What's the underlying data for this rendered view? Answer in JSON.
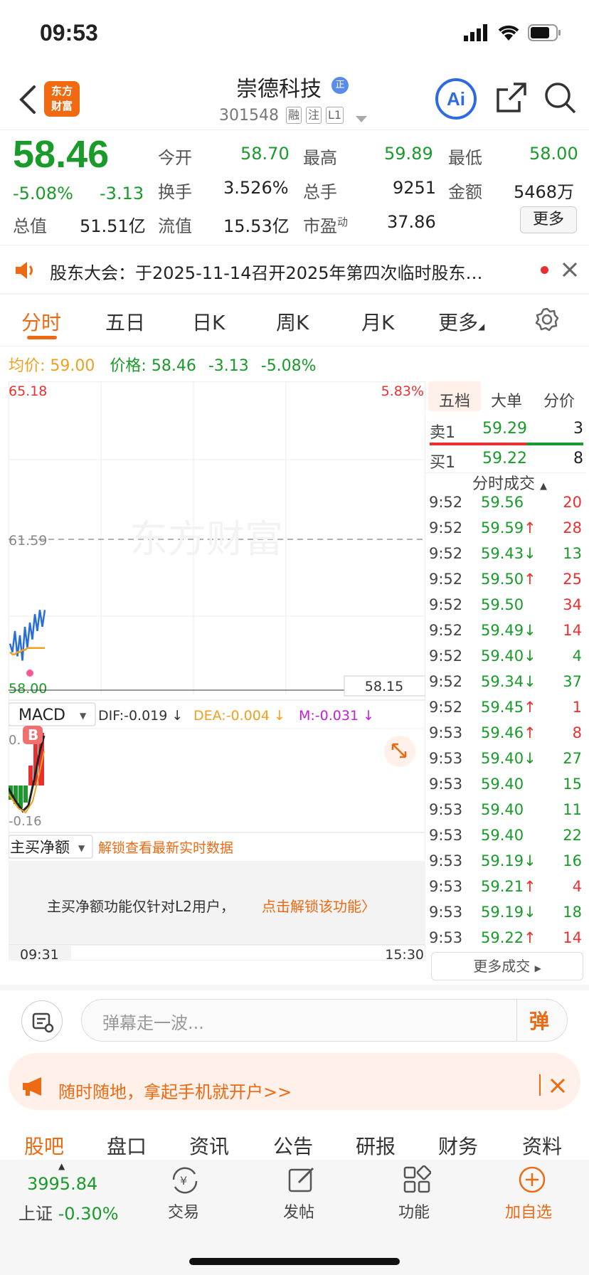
{
  "status": {
    "time": "09:53"
  },
  "header": {
    "logo_text": "东方财富",
    "stock_name": "崇德科技",
    "stock_code": "301548",
    "tags": [
      "融",
      "注",
      "L1"
    ],
    "ai_label": "Ai"
  },
  "quote": {
    "price": "58.46",
    "change_pct": "-5.08%",
    "change": "-3.13",
    "open_label": "今开",
    "open": "58.70",
    "high_label": "最高",
    "high": "59.89",
    "low_label": "最低",
    "low": "58.00",
    "turnover_label": "换手",
    "turnover": "3.526%",
    "volume_label": "总手",
    "volume": "9251",
    "amount_label": "金额",
    "amount": "5468万",
    "mktcap_label": "总值",
    "mktcap": "51.51亿",
    "float_label": "流值",
    "float_cap": "15.53亿",
    "pe_label": "市盈",
    "pe_sup": "动",
    "pe": "37.86",
    "more_label": "更多"
  },
  "notice": {
    "text": "股东大会：于2025-11-14召开2025年第四次临时股东…"
  },
  "ktabs": [
    "分时",
    "五日",
    "日K",
    "周K",
    "月K",
    "更多"
  ],
  "avg": {
    "avg_label": "均价:",
    "avg_value": "59.00",
    "price_label": "价格:",
    "price": "58.46",
    "change": "-3.13",
    "change_pct": "-5.08%"
  },
  "chart_data": {
    "type": "line",
    "y_top": "65.18",
    "y_mid": "61.59",
    "y_bottom": "58.00",
    "pct_top": "5.83%",
    "crosshair_value": "58.15",
    "x_start": "09:31",
    "x_end": "15:30",
    "ylim": [
      58.0,
      65.18
    ],
    "series": [
      {
        "values": [
          59.1,
          58.9,
          59.4,
          58.8,
          59.3,
          58.7,
          59.5,
          59.0,
          59.6,
          59.2,
          59.8,
          59.4,
          59.9,
          59.5,
          59.9
        ]
      },
      {
        "values": [
          58.9,
          58.85,
          58.85,
          58.9,
          58.9,
          58.95,
          58.95,
          59.0,
          59.0,
          59.0,
          59.0,
          59.0,
          59.0,
          59.0,
          59.0
        ]
      }
    ],
    "watermark": "东方财富"
  },
  "macd": {
    "label": "MACD",
    "dif": "DIF:-0.019 ↓",
    "dea": "DEA:-0.004 ↓",
    "m": "M:-0.031 ↓",
    "y_top": "0.",
    "y_bottom": "-0.16",
    "b_marker": "B"
  },
  "netbuy": {
    "label": "主买净额",
    "unlock_link": "解锁查看最新实时数据",
    "desc": "主买净额功能仅针对L2用户，",
    "desc_link": "点击解锁该功能〉"
  },
  "orderbook": {
    "tabs": [
      "五档",
      "大单",
      "分价"
    ],
    "sell1": {
      "label": "卖1",
      "price": "59.29",
      "vol": "3"
    },
    "buy1": {
      "label": "买1",
      "price": "59.22",
      "vol": "8"
    },
    "trades_title": "分时成交",
    "trades": [
      {
        "t": "9:52",
        "p": "59.56",
        "a": "",
        "v": "20",
        "c": "green",
        "vc": "red"
      },
      {
        "t": "9:52",
        "p": "59.59",
        "a": "↑",
        "v": "28",
        "c": "green",
        "vc": "red"
      },
      {
        "t": "9:52",
        "p": "59.43",
        "a": "↓",
        "v": "13",
        "c": "green",
        "vc": "green"
      },
      {
        "t": "9:52",
        "p": "59.50",
        "a": "↑",
        "v": "25",
        "c": "green",
        "vc": "red"
      },
      {
        "t": "9:52",
        "p": "59.50",
        "a": "",
        "v": "34",
        "c": "green",
        "vc": "red"
      },
      {
        "t": "9:52",
        "p": "59.49",
        "a": "↓",
        "v": "14",
        "c": "green",
        "vc": "red"
      },
      {
        "t": "9:52",
        "p": "59.40",
        "a": "↓",
        "v": "4",
        "c": "green",
        "vc": "green"
      },
      {
        "t": "9:52",
        "p": "59.34",
        "a": "↓",
        "v": "37",
        "c": "green",
        "vc": "green"
      },
      {
        "t": "9:52",
        "p": "59.45",
        "a": "↑",
        "v": "1",
        "c": "green",
        "vc": "red"
      },
      {
        "t": "9:53",
        "p": "59.46",
        "a": "↑",
        "v": "8",
        "c": "green",
        "vc": "red"
      },
      {
        "t": "9:53",
        "p": "59.40",
        "a": "↓",
        "v": "27",
        "c": "green",
        "vc": "green"
      },
      {
        "t": "9:53",
        "p": "59.40",
        "a": "",
        "v": "15",
        "c": "green",
        "vc": "green"
      },
      {
        "t": "9:53",
        "p": "59.40",
        "a": "",
        "v": "11",
        "c": "green",
        "vc": "green"
      },
      {
        "t": "9:53",
        "p": "59.40",
        "a": "",
        "v": "22",
        "c": "green",
        "vc": "green"
      },
      {
        "t": "9:53",
        "p": "59.19",
        "a": "↓",
        "v": "16",
        "c": "green",
        "vc": "green"
      },
      {
        "t": "9:53",
        "p": "59.21",
        "a": "↑",
        "v": "4",
        "c": "green",
        "vc": "red"
      },
      {
        "t": "9:53",
        "p": "59.19",
        "a": "↓",
        "v": "18",
        "c": "green",
        "vc": "green"
      },
      {
        "t": "9:53",
        "p": "59.22",
        "a": "↑",
        "v": "14",
        "c": "green",
        "vc": "red"
      }
    ],
    "more_label": "更多成交"
  },
  "danmu": {
    "placeholder": "弹幕走一波...",
    "send_label": "弹"
  },
  "promo": {
    "text": "随时随地，拿起手机就开户>>"
  },
  "bottom_tabs": [
    "股吧",
    "盘口",
    "资讯",
    "公告",
    "研报",
    "财务",
    "资料"
  ],
  "bottom_bar": {
    "index_value": "3995.84",
    "index_name": "上证",
    "index_change": "-0.30%",
    "trade": "交易",
    "post": "发帖",
    "func": "功能",
    "add": "加自选"
  },
  "colors": {
    "accent": "#ee6a12",
    "up": "#e93030",
    "down": "#1a9a2a",
    "line": "#2a6fd6",
    "avg": "#f0a020"
  }
}
